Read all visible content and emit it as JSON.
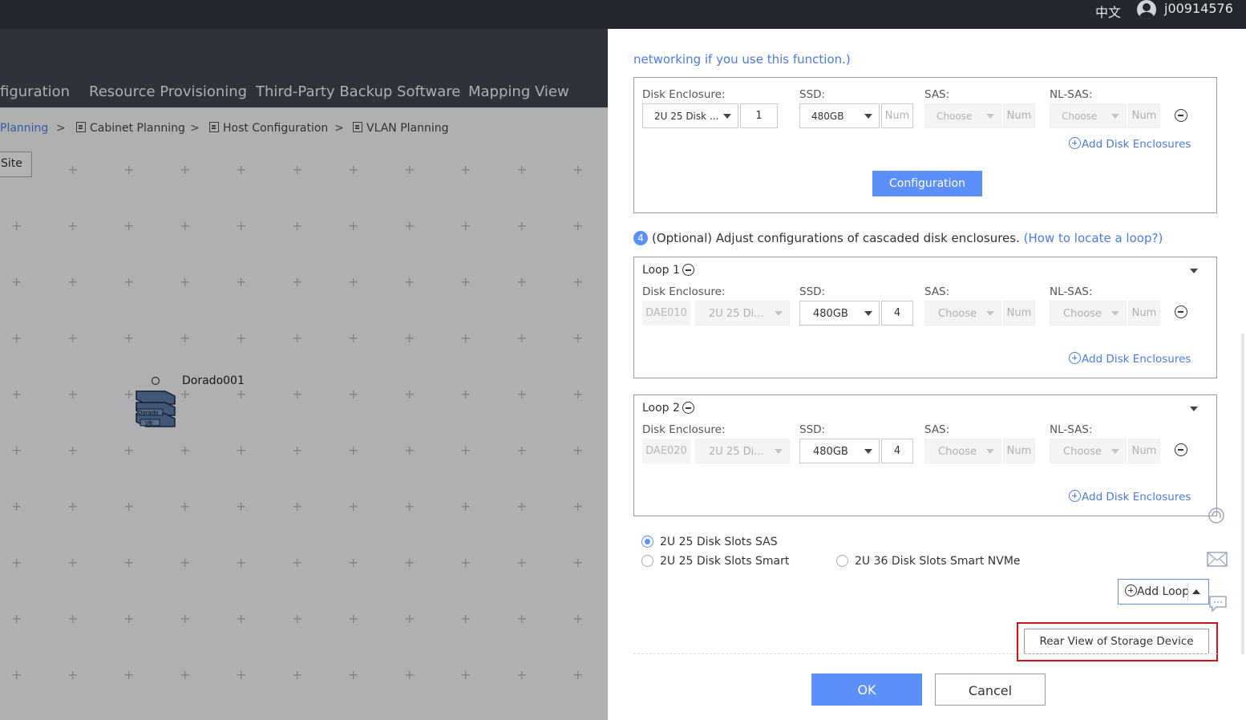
{
  "topbar": {
    "language": "中文",
    "username": "j00914576"
  },
  "bg": {
    "nav": [
      "figuration",
      "Resource Provisioning",
      "Third-Party Backup Software",
      "Mapping View"
    ],
    "breadcrumb": {
      "planning": "Planning",
      "cabinet": "Cabinet Planning",
      "host": "Host Configuration",
      "vlan": "VLAN Planning",
      "sep": ">"
    },
    "site_button": "Site",
    "device_label": "Dorado001",
    "device_text1": "Dorado",
    "device_text2": "V6"
  },
  "dialog": {
    "note": "networking if you use this function.)",
    "labels": {
      "disk_enclosure": "Disk Enclosure:",
      "ssd": "SSD:",
      "sas": "SAS:",
      "nl_sas": "NL-SAS:"
    },
    "top_row": {
      "enclosure": "2U 25 Disk ...",
      "enclosure_count": "1",
      "ssd": "480GB",
      "ssd_num_placeholder": "Num",
      "sas": "Choose",
      "sas_num": "Num",
      "nlsas": "Choose",
      "nlsas_num": "Num"
    },
    "add_disk_enclosures": "Add Disk Enclosures",
    "configuration_button": "Configuration",
    "step": {
      "number": "4",
      "text": "(Optional) Adjust configurations of cascaded disk enclosures.",
      "link": "(How to locate a loop?)"
    },
    "loops": [
      {
        "title": "Loop 1",
        "dae": "DAE010",
        "enclosure": "2U 25 Di...",
        "ssd": "480GB",
        "count": "4",
        "sas": "Choose",
        "sas_num": "Num",
        "nlsas": "Choose",
        "nlsas_num": "Num"
      },
      {
        "title": "Loop 2",
        "dae": "DAE020",
        "enclosure": "2U 25 Di...",
        "ssd": "480GB",
        "count": "4",
        "sas": "Choose",
        "sas_num": "Num",
        "nlsas": "Choose",
        "nlsas_num": "Num"
      }
    ],
    "radios": [
      "2U 25 Disk Slots SAS",
      "2U 25 Disk Slots Smart",
      "2U 36 Disk Slots Smart NVMe"
    ],
    "add_loop": "Add Loop",
    "rear_view": "Rear View of Storage Device",
    "ok": "OK",
    "cancel": "Cancel"
  },
  "colors": {
    "accent": "#5b8ff9",
    "link": "#4a7be0",
    "highlight": "#d0121b",
    "topbar": "#23262d"
  }
}
